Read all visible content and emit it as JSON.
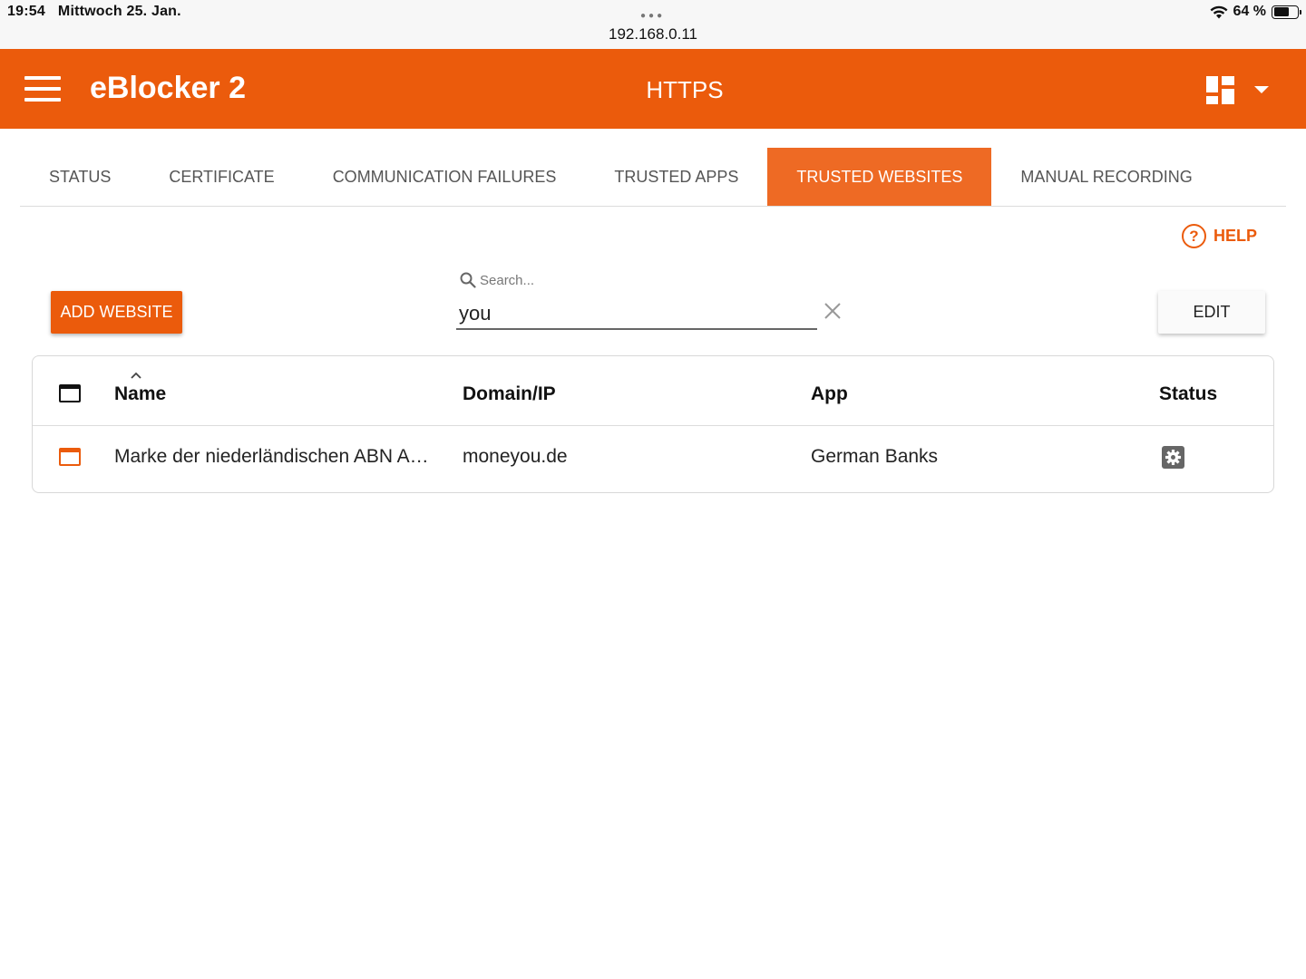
{
  "statusbar": {
    "time": "19:54",
    "date": "Mittwoch 25. Jan.",
    "url": "192.168.0.11",
    "battery": "64 %",
    "battery_level": 0.64
  },
  "appbar": {
    "title": "eBlocker 2",
    "page_title": "HTTPS",
    "brand_color": "#eb5b0c"
  },
  "tabs": [
    {
      "label": "STATUS",
      "active": false
    },
    {
      "label": "CERTIFICATE",
      "active": false
    },
    {
      "label": "COMMUNICATION FAILURES",
      "active": false
    },
    {
      "label": "TRUSTED APPS",
      "active": false
    },
    {
      "label": "TRUSTED WEBSITES",
      "active": true
    },
    {
      "label": "MANUAL RECORDING",
      "active": false
    }
  ],
  "help": {
    "label": "HELP"
  },
  "toolbar": {
    "add_label": "ADD WEBSITE",
    "search_placeholder": "Search...",
    "search_value": "you",
    "edit_label": "EDIT"
  },
  "table": {
    "headers": {
      "name": "Name",
      "domain": "Domain/IP",
      "app": "App",
      "status": "Status"
    },
    "rows": [
      {
        "name": "Marke der niederländischen ABN A…",
        "domain": "moneyou.de",
        "app": "German Banks",
        "status_icon": "gear-icon"
      }
    ]
  }
}
